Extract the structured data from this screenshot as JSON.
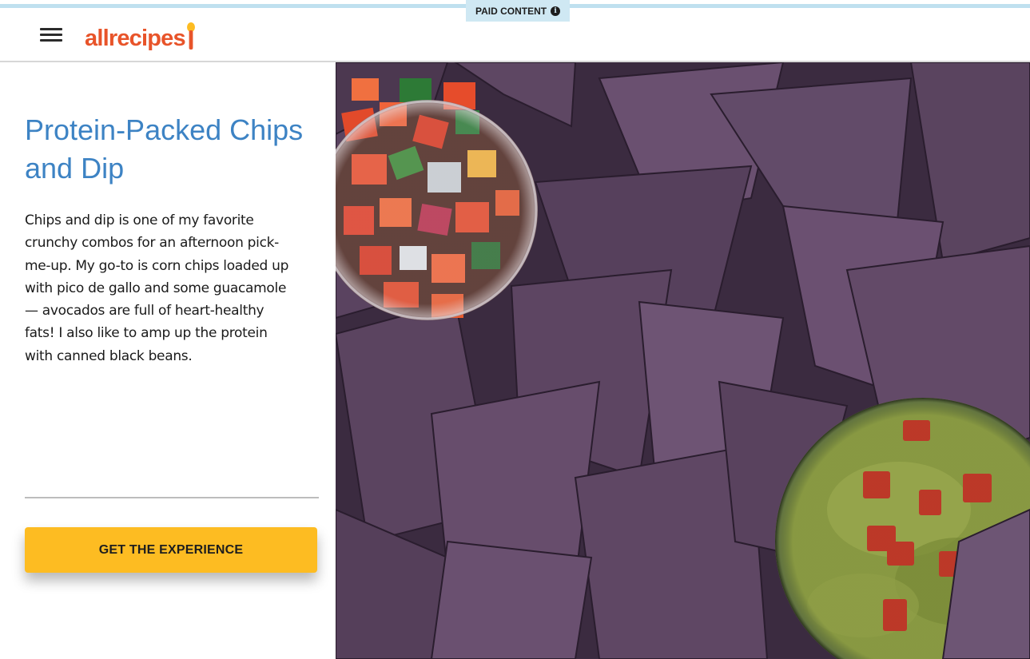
{
  "header": {
    "logo_text": "allrecipes",
    "paid_label": "PAID CONTENT",
    "menu_icon": "hamburger-menu-icon",
    "info_icon": "info-icon"
  },
  "article": {
    "title": "Protein-Packed Chips and Dip",
    "description": "Chips and dip is one of my favorite crunchy combos for an afternoon pick-me-up. My go-to is corn chips loaded up with pico de gallo and some guacamole — avocados are full of heart-healthy fats! I also like to amp up the protein with canned black beans.",
    "cta_label": "GET THE EXPERIENCE"
  },
  "colors": {
    "brand": "#e8542a",
    "title": "#3d83c4",
    "cta": "#fdbc22",
    "paid_badge": "#cfe8f3",
    "chips": "#5b4461"
  }
}
